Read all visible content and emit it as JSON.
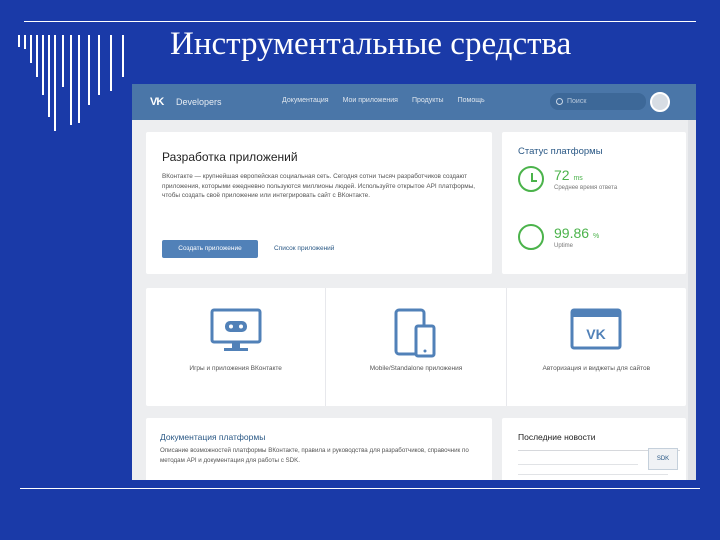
{
  "slide": {
    "title": "Инструментальные средства"
  },
  "header": {
    "logo_text": "Developers",
    "nav": [
      "Документация",
      "Мои приложения",
      "Продукты",
      "Помощь"
    ],
    "search_placeholder": "Поиск"
  },
  "dev_card": {
    "title": "Разработка приложений",
    "text": "ВКонтакте — крупнейшая европейская социальная сеть. Сегодня сотни тысяч разработчиков создают приложения, которыми ежедневно пользуются миллионы людей. Используйте открытое API платформы, чтобы создать своё приложение или интегрировать сайт с ВКонтакте.",
    "primary_button": "Создать приложение",
    "secondary_link": "Список приложений"
  },
  "status_card": {
    "title": "Статус платформы",
    "latency_value": "72",
    "latency_unit": "ms",
    "latency_label": "Среднее время ответа",
    "uptime_value": "99.86",
    "uptime_unit": "%",
    "uptime_label": "Uptime"
  },
  "products": [
    {
      "label": "Игры и приложения ВКонтакте",
      "icon": "gamepad-monitor-icon"
    },
    {
      "label": "Mobile/Standalone приложения",
      "icon": "devices-icon"
    },
    {
      "label": "Авторизация и виджеты для сайтов",
      "icon": "vk-window-icon"
    }
  ],
  "docs_card": {
    "title": "Документация платформы",
    "text": "Описание возможностей платформы ВКонтакте, правила и руководства для разработчиков, справочник по методам API и документация для работы с SDK."
  },
  "news_card": {
    "title": "Последние новости",
    "badge": "SDK"
  },
  "colors": {
    "slide_bg": "#1a3aa8",
    "vk_header": "#4a76a8",
    "accent_green": "#4bb34b",
    "link_blue": "#2a5885"
  }
}
